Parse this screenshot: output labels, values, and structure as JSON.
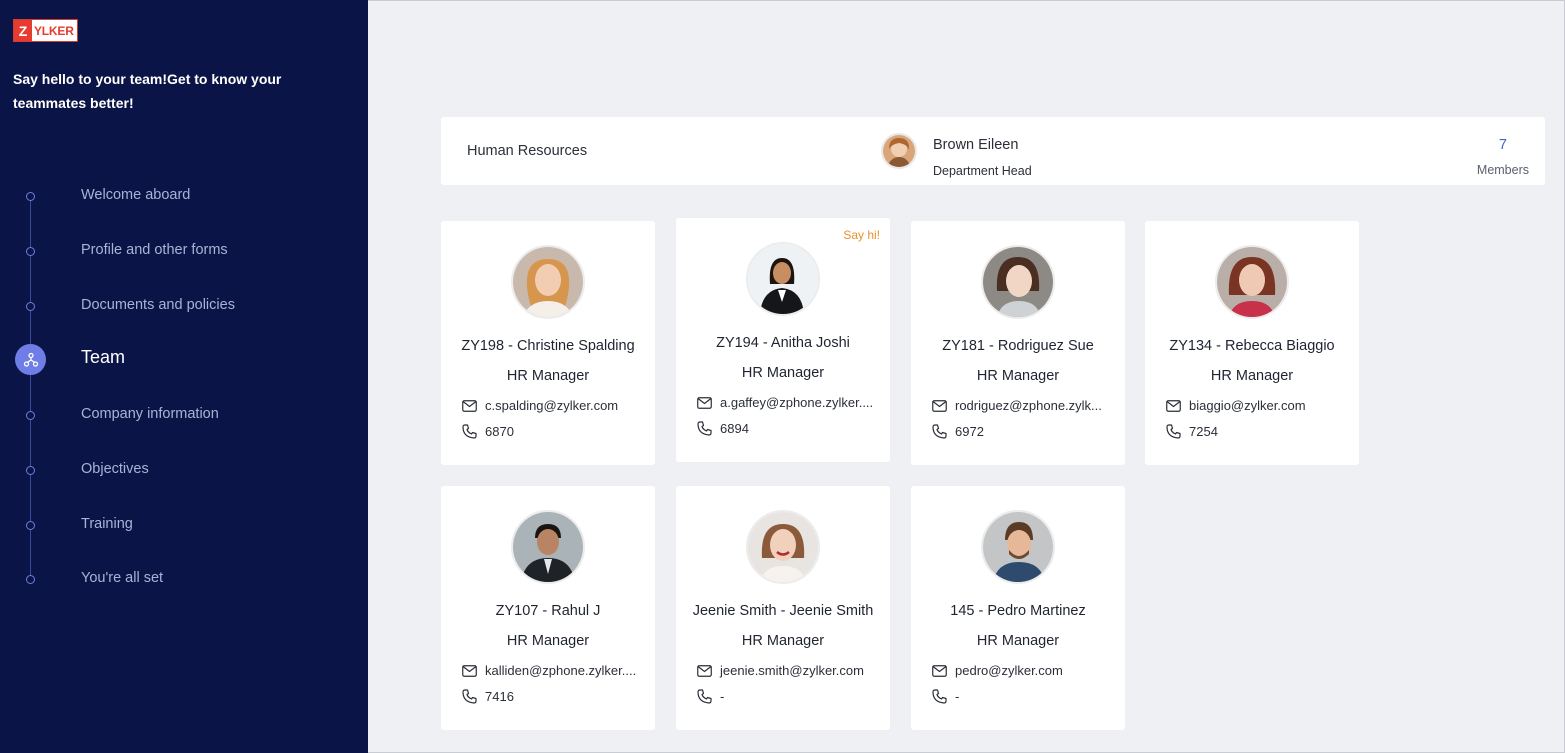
{
  "brand": {
    "logo_letter": "Z",
    "logo_rest": "YLKER"
  },
  "sidebar": {
    "tagline": "Say hello to your team!Get to know your teammates better!",
    "steps": [
      {
        "label": "Welcome aboard"
      },
      {
        "label": "Profile and other forms"
      },
      {
        "label": "Documents and policies"
      },
      {
        "label": "Team",
        "active": true
      },
      {
        "label": "Company information"
      },
      {
        "label": "Objectives"
      },
      {
        "label": "Training"
      },
      {
        "label": "You're all set"
      }
    ]
  },
  "department": {
    "name": "Human Resources",
    "head_name": "Brown Eileen",
    "head_role": "Department Head",
    "members_count": "7",
    "members_label": "Members"
  },
  "members": [
    {
      "name": "ZY198 - Christine Spalding",
      "role": "HR Manager",
      "email": "c.spalding@zylker.com",
      "phone": "6870"
    },
    {
      "name": "ZY194 - Anitha Joshi",
      "role": "HR Manager",
      "email": "a.gaffey@zphone.zylker....",
      "phone": "6894",
      "badge": "Say hi!"
    },
    {
      "name": "ZY181 - Rodriguez Sue",
      "role": "HR Manager",
      "email": "rodriguez@zphone.zylk...",
      "phone": "6972"
    },
    {
      "name": "ZY134 - Rebecca Biaggio",
      "role": "HR Manager",
      "email": "biaggio@zylker.com",
      "phone": "7254"
    },
    {
      "name": "ZY107 - Rahul J",
      "role": "HR Manager",
      "email": "kalliden@zphone.zylker....",
      "phone": "7416"
    },
    {
      "name": "Jeenie Smith - Jeenie Smith",
      "role": "HR Manager",
      "email": "jeenie.smith@zylker.com",
      "phone": "-"
    },
    {
      "name": "145 - Pedro Martinez",
      "role": "HR Manager",
      "email": "pedro@zylker.com",
      "phone": "-"
    }
  ],
  "colors": {
    "sidebar_bg": "#0b1446",
    "accent": "#6f7ee6",
    "say_hi": "#e8912b",
    "brand_red": "#e63b2e"
  }
}
